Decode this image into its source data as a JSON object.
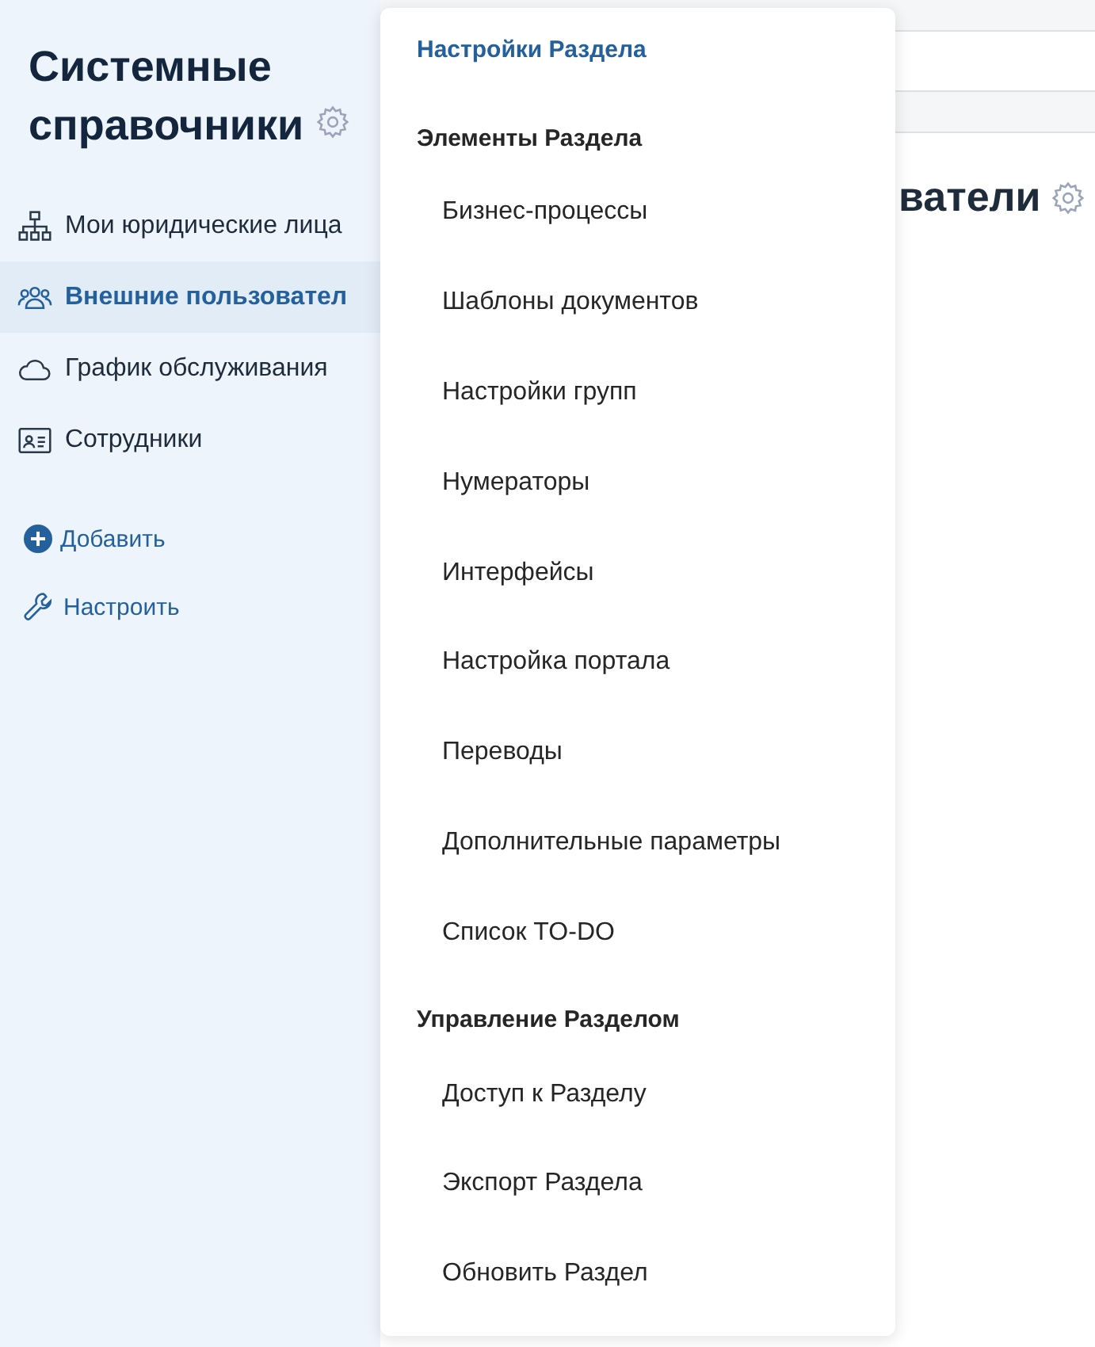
{
  "sidebar": {
    "title": "Системные справочники",
    "items": [
      {
        "label": "Мои юридические лица",
        "selected": false
      },
      {
        "label": "Внешние пользовател",
        "selected": true
      },
      {
        "label": "График обслуживания",
        "selected": false
      },
      {
        "label": "Сотрудники",
        "selected": false
      }
    ],
    "actions": [
      "Добавить",
      "Настроить"
    ]
  },
  "main": {
    "heading": "ватели"
  },
  "menu": {
    "title": "Настройки Раздела",
    "sections": [
      {
        "heading": "Элементы Раздела",
        "items": [
          "Бизнес-процессы",
          "Шаблоны документов",
          "Настройки групп",
          "Нумераторы",
          "Интерфейсы",
          "Настройка портала",
          "Переводы",
          "Дополнительные параметры",
          "Список TO-DO"
        ]
      },
      {
        "heading": "Управление Разделом",
        "items": [
          "Доступ к Разделу",
          "Экспорт Раздела",
          "Обновить Раздел"
        ]
      }
    ]
  }
}
